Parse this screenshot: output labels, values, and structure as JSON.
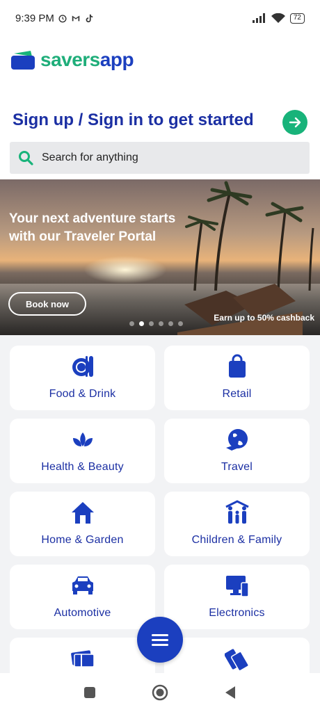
{
  "status": {
    "time": "9:39 PM",
    "battery": "72"
  },
  "brand": {
    "name_part1": "savers",
    "name_part2": "app"
  },
  "header": {
    "signin_text": "Sign up / Sign in to get started"
  },
  "search": {
    "placeholder": "Search for anything"
  },
  "banner": {
    "headline": "Your next adventure starts with our Traveler Portal",
    "cta_label": "Book now",
    "cashback_text": "Earn up to 50% cashback",
    "slides": 6,
    "active_slide": 2
  },
  "categories": [
    {
      "label": "Food & Drink",
      "icon": "food-drink-icon"
    },
    {
      "label": "Retail",
      "icon": "shopping-bag-icon"
    },
    {
      "label": "Health & Beauty",
      "icon": "lotus-icon"
    },
    {
      "label": "Travel",
      "icon": "globe-plane-icon"
    },
    {
      "label": "Home & Garden",
      "icon": "house-icon"
    },
    {
      "label": "Children & Family",
      "icon": "family-icon"
    },
    {
      "label": "Automotive",
      "icon": "car-icon"
    },
    {
      "label": "Electronics",
      "icon": "devices-icon"
    },
    {
      "label": "",
      "icon": "gift-card-icon"
    },
    {
      "label": "",
      "icon": "tickets-icon"
    }
  ],
  "colors": {
    "brand_blue": "#1b3fbf",
    "brand_green": "#18b37a",
    "text_blue": "#1b2fa3"
  }
}
